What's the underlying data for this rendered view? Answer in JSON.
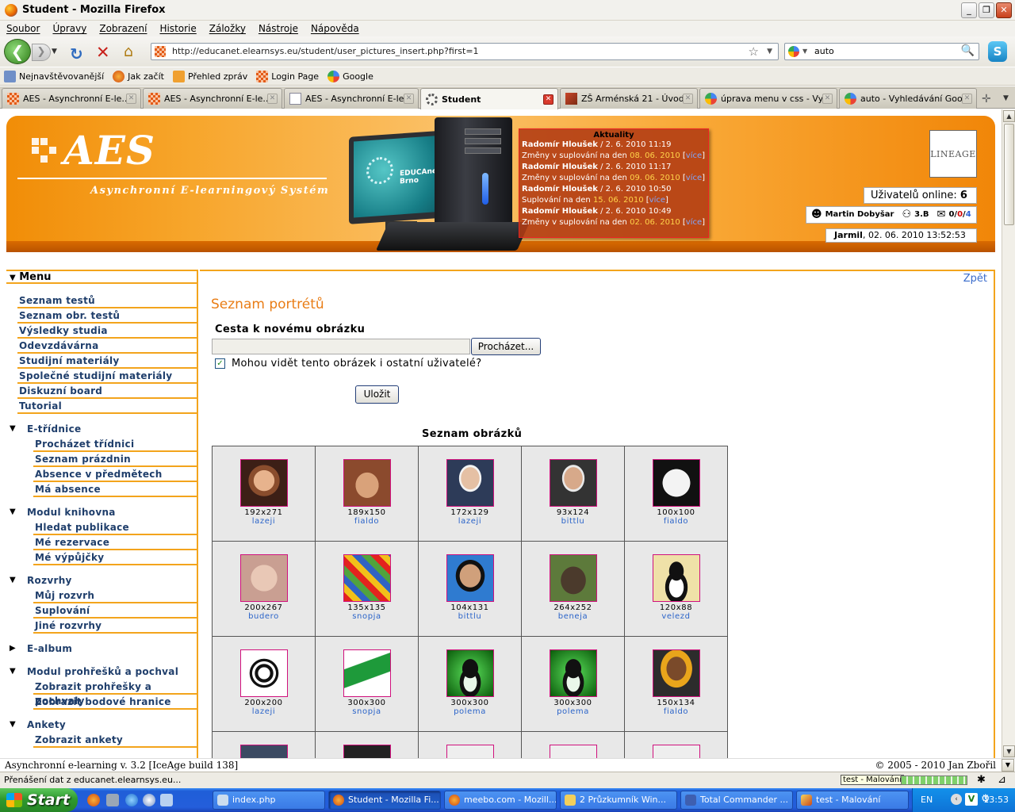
{
  "window": {
    "title": "Student - Mozilla Firefox"
  },
  "menubar": [
    "Soubor",
    "Úpravy",
    "Zobrazení",
    "Historie",
    "Záložky",
    "Nástroje",
    "Nápověda"
  ],
  "nav": {
    "url": "http://educanet.elearnsys.eu/student/user_pictures_insert.php?first=1",
    "search_value": "auto"
  },
  "bookmarks": [
    "Nejnavštěvovanější",
    "Jak začít",
    "Přehled zpráv",
    "Login Page",
    "Google"
  ],
  "tabs": [
    {
      "label": "AES - Asynchronní E-le...",
      "icon": "aes-icon",
      "active": false
    },
    {
      "label": "AES - Asynchronní E-le...",
      "icon": "aes-icon",
      "active": false
    },
    {
      "label": "AES - Asynchronní E-le...",
      "icon": "page-icon",
      "active": false
    },
    {
      "label": "Student",
      "icon": "loading-icon",
      "active": true
    },
    {
      "label": "ZŠ Arménská 21 - Úvod",
      "icon": "zs-icon",
      "active": false
    },
    {
      "label": "úprava menu v css - Vy...",
      "icon": "google-icon",
      "active": false
    },
    {
      "label": "auto - Vyhledávání Goo...",
      "icon": "google-icon",
      "active": false
    }
  ],
  "banner": {
    "logo": "AES",
    "subtitle": "Asynchronní E-learningový Systém",
    "monitor_text": "EDUCAnet Brno",
    "lineage": "LINEAGE",
    "online_label": "Uživatelů online:",
    "online_count": "6",
    "user_name": "Martin Dobyšar",
    "user_class": "3.B",
    "msg_a": "0",
    "msg_b": "0",
    "msg_c": "4",
    "date_user": "Jarmil",
    "date_text": ", 02. 06. 2010 13:52:53"
  },
  "news": {
    "heading": "Aktuality",
    "items": [
      {
        "author": "Radomír Hloušek",
        "when": " / 2. 6. 2010 11:19",
        "text": "Změny v suplování na den ",
        "date": "08. 06. 2010",
        "more": "více"
      },
      {
        "author": "Radomír Hloušek",
        "when": " / 2. 6. 2010 11:17",
        "text": "Změny v suplování na den ",
        "date": "09. 06. 2010",
        "more": "více"
      },
      {
        "author": "Radomír Hloušek",
        "when": " / 2. 6. 2010 10:50",
        "text": "Suplování na den ",
        "date": "15. 06. 2010",
        "more": "více"
      },
      {
        "author": "Radomír Hloušek",
        "when": " / 2. 6. 2010 10:49",
        "text": "Změny v suplování na den ",
        "date": "02. 06. 2010",
        "more": "více"
      }
    ]
  },
  "menu": {
    "title": "Menu",
    "top_items": [
      "Seznam testů",
      "Seznam obr. testů",
      "Výsledky studia",
      "Odevzdávárna",
      "Studijní materiály",
      "Společné studijní materiály",
      "Diskuzní board",
      "Tutorial"
    ],
    "groups": [
      {
        "label": "E-třídnice",
        "expanded": true,
        "items": [
          "Procházet třídnici",
          "Seznam prázdnin",
          "Absence v předmětech",
          "Má absence"
        ]
      },
      {
        "label": "Modul knihovna",
        "expanded": true,
        "items": [
          "Hledat publikace",
          "Mé rezervace",
          "Mé výpůjčky"
        ]
      },
      {
        "label": "Rozvrhy",
        "expanded": true,
        "items": [
          "Můj rozvrh",
          "Suplování",
          "Jiné rozvrhy"
        ]
      },
      {
        "label": "E-album",
        "expanded": false,
        "items": []
      },
      {
        "label": "Modul prohřešků a pochval",
        "expanded": true,
        "items": [
          "Zobrazit prohřešky a pochvaly",
          "Zobrazit bodové hranice"
        ]
      },
      {
        "label": "Ankety",
        "expanded": true,
        "items": [
          "Zobrazit ankety"
        ]
      }
    ]
  },
  "main": {
    "back_link": "Zpět",
    "title": "Seznam portrétů",
    "path_label": "Cesta k novému obrázku",
    "file_value": "",
    "browse_label": "Procházet...",
    "checkbox_label": "Mohou vidět tento obrázek i ostatní uživatelé?",
    "checkbox_checked": true,
    "save_label": "Uložit",
    "list_title": "Seznam obrázků"
  },
  "gallery": [
    [
      {
        "dim": "192x271",
        "user": "lazeji",
        "thumb": "face"
      },
      {
        "dim": "189x150",
        "user": "fialdo",
        "thumb": "face2"
      },
      {
        "dim": "172x129",
        "user": "lazeji",
        "thumb": "suit"
      },
      {
        "dim": "93x124",
        "user": "bittlu",
        "thumb": "suit2"
      },
      {
        "dim": "100x100",
        "user": "fialdo",
        "thumb": "clown"
      }
    ],
    [
      {
        "dim": "200x267",
        "user": "budero",
        "thumb": "old"
      },
      {
        "dim": "135x135",
        "user": "snopja",
        "thumb": "poster"
      },
      {
        "dim": "104x131",
        "user": "bittlu",
        "thumb": "asian"
      },
      {
        "dim": "264x252",
        "user": "beneja",
        "thumb": "rock"
      },
      {
        "dim": "120x88",
        "user": "velezd",
        "thumb": "tux"
      }
    ],
    [
      {
        "dim": "200x200",
        "user": "lazeji",
        "thumb": "emblem"
      },
      {
        "dim": "300x300",
        "user": "snopja",
        "thumb": "shoe"
      },
      {
        "dim": "300x300",
        "user": "polema",
        "thumb": "tuxg"
      },
      {
        "dim": "300x300",
        "user": "polema",
        "thumb": "tuxg"
      },
      {
        "dim": "150x134",
        "user": "fialdo",
        "thumb": "kid"
      }
    ]
  ],
  "footer": {
    "left": "Asynchronní e-learning  v. 3.2 [IceAge build 138]",
    "right": "© 2005 - 2010  Jan Zbořil"
  },
  "status": {
    "text": "Přenášení dat z educanet.elearnsys.eu...",
    "tooltip": "test - Malování"
  },
  "taskbar": {
    "start": "Start",
    "tasks": [
      {
        "label": "index.php",
        "active": false
      },
      {
        "label": "Student - Mozilla Fi...",
        "active": true
      },
      {
        "label": "meebo.com - Mozill...",
        "active": false
      },
      {
        "label": "2 Průzkumník Win...",
        "active": false
      },
      {
        "label": "Total Commander ...",
        "active": false
      },
      {
        "label": "test - Malování",
        "active": false
      }
    ],
    "lang": "EN",
    "clock": "13:53"
  }
}
